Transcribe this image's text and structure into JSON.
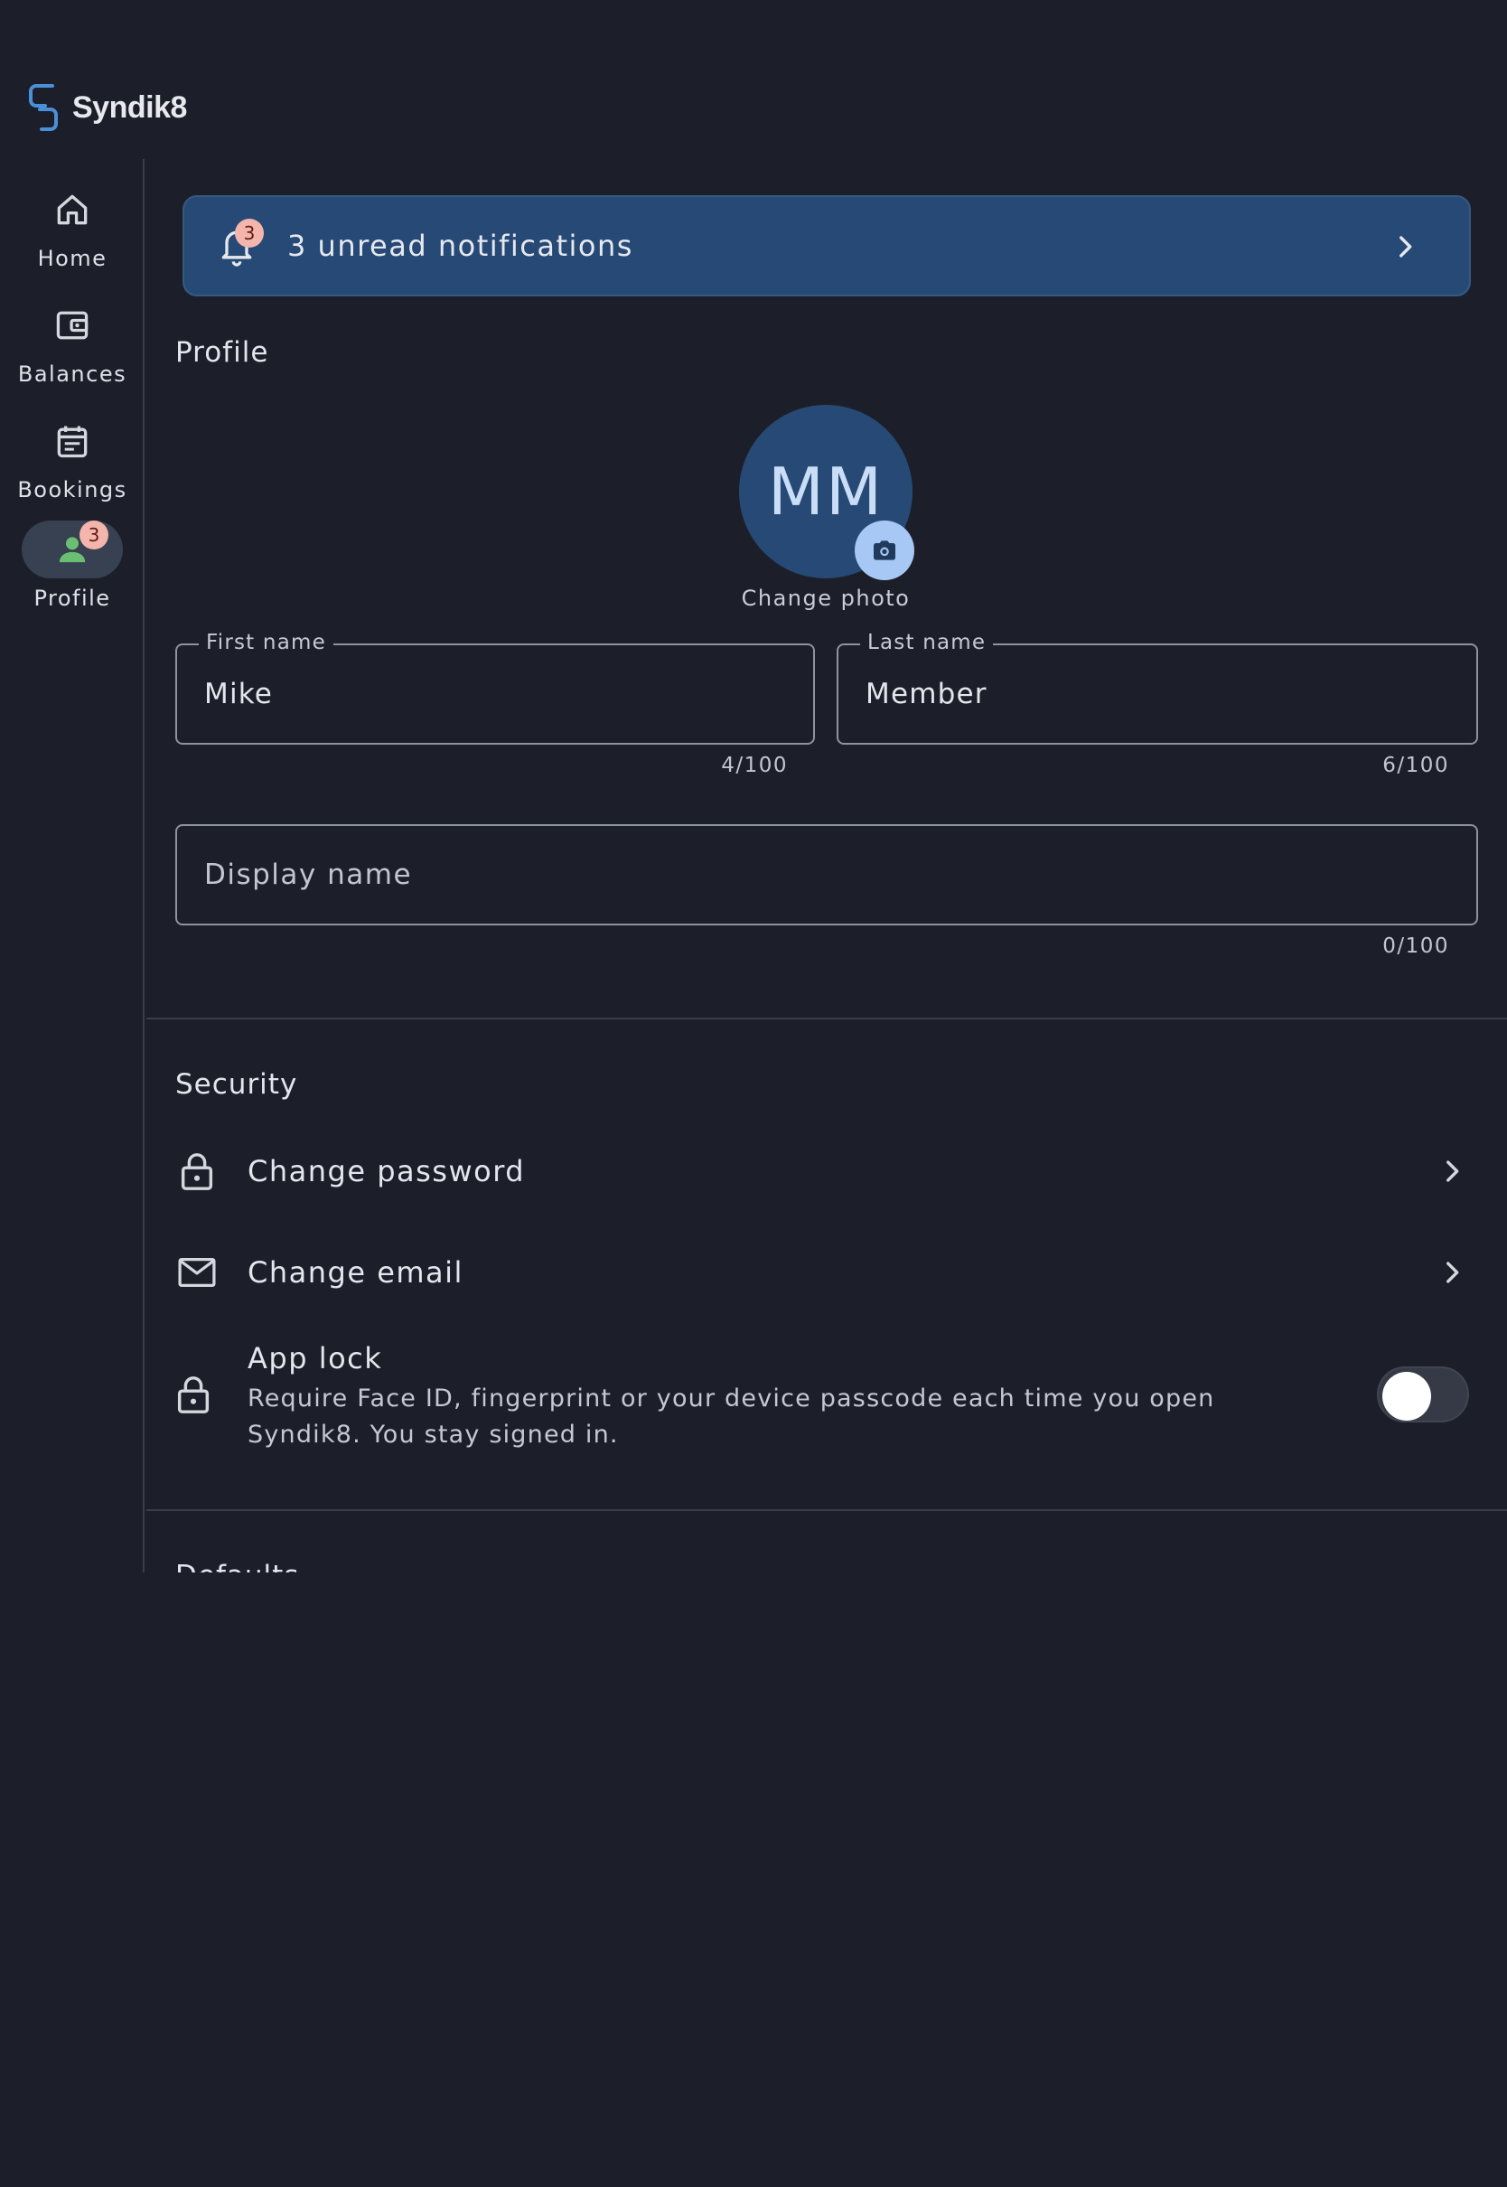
{
  "app": {
    "name": "Syndik8",
    "accent_color": "#4a90d9"
  },
  "nav": {
    "items": [
      {
        "label": "Home",
        "icon": "home-icon"
      },
      {
        "label": "Balances",
        "icon": "wallet-icon"
      },
      {
        "label": "Bookings",
        "icon": "calendar-icon"
      },
      {
        "label": "Profile",
        "icon": "person-icon",
        "badge": "3",
        "active": true
      }
    ]
  },
  "notifications": {
    "badge": "3",
    "text": "3 unread notifications"
  },
  "profile": {
    "section_title": "Profile",
    "avatar_initials": "MM",
    "change_photo_label": "Change photo",
    "first_name": {
      "label": "First name",
      "value": "Mike",
      "counter": "4/100"
    },
    "last_name": {
      "label": "Last name",
      "value": "Member",
      "counter": "6/100"
    },
    "display_name": {
      "placeholder": "Display name",
      "value": "",
      "counter": "0/100"
    }
  },
  "security": {
    "section_title": "Security",
    "change_password_label": "Change password",
    "change_email_label": "Change email",
    "app_lock": {
      "title": "App lock",
      "description": "Require Face ID, fingerprint or your device passcode each time you open Syndik8. You stay signed in.",
      "enabled": false
    }
  },
  "defaults": {
    "section_title": "Defaults"
  }
}
